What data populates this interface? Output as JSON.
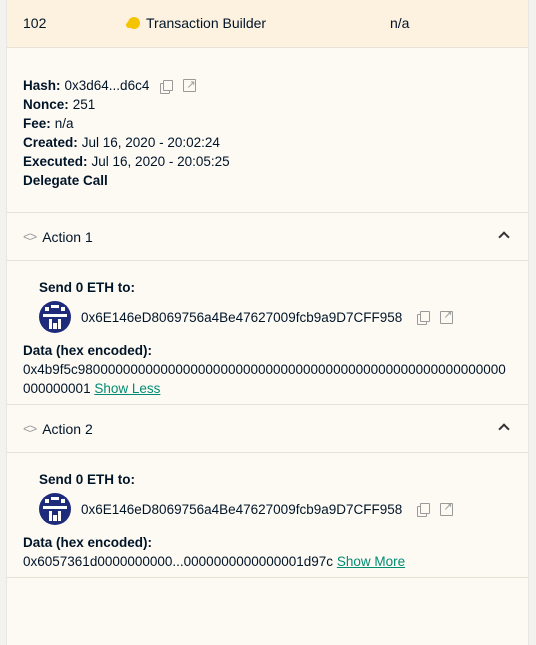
{
  "tx": {
    "nonce": "102",
    "type_label": "Transaction Builder",
    "value": "n/a"
  },
  "details": {
    "hash_label": "Hash:",
    "hash_value": "0x3d64...d6c4",
    "nonce_label": "Nonce:",
    "nonce_value": "251",
    "fee_label": "Fee:",
    "fee_value": "n/a",
    "created_label": "Created:",
    "created_value": "Jul 16, 2020 - 20:02:24",
    "executed_label": "Executed:",
    "executed_value": "Jul 16, 2020 - 20:05:25",
    "delegate_label": "Delegate Call"
  },
  "actions": [
    {
      "title": "Action 1",
      "send_label": "Send 0 ETH to:",
      "address": "0x6E146eD8069756a4Be47627009fcb9a9D7CFF958",
      "data_label": "Data (hex encoded):",
      "data_value": "0x4b9f5c980000000000000000000000000000000000000000000000000000000000000001",
      "toggle_label": "Show Less"
    },
    {
      "title": "Action 2",
      "send_label": "Send 0 ETH to:",
      "address": "0x6E146eD8069756a4Be47627009fcb9a9D7CFF958",
      "data_label": "Data (hex encoded):",
      "data_value": "0x6057361d0000000000...0000000000000001d97c",
      "toggle_label": "Show More"
    }
  ],
  "colors": {
    "accent": "#008c73",
    "row_highlight": "#fdf1df",
    "panel_bg": "#fdfaf4"
  }
}
